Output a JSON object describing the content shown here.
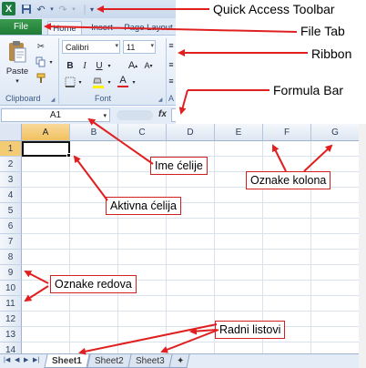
{
  "app": {
    "logo_letter": "X",
    "tabs": {
      "file": "File",
      "home": "Home",
      "insert": "Insert",
      "page_layout": "Page Layout"
    },
    "ribbon": {
      "paste_label": "Paste",
      "clipboard_label": "Clipboard",
      "font_label": "Font",
      "font_name": "Calibri",
      "font_size": "11",
      "bold": "B",
      "italic": "I",
      "underline": "U",
      "grow_font": "A",
      "shrink_font": "A",
      "font_color": "A",
      "partial_group_letter": "A"
    },
    "name_box": "A1",
    "fx_label": "fx",
    "columns": [
      "A",
      "B",
      "C",
      "D",
      "E",
      "F",
      "G"
    ],
    "rows": [
      "1",
      "2",
      "3",
      "4",
      "5",
      "6",
      "7",
      "8",
      "9",
      "10",
      "11",
      "12",
      "13",
      "14"
    ],
    "selected_column": "A",
    "selected_row": "1",
    "sheets": [
      "Sheet1",
      "Sheet2",
      "Sheet3"
    ],
    "active_sheet": "Sheet1"
  },
  "callouts": {
    "quick_access_toolbar": "Quick Access Toolbar",
    "file_tab": "File Tab",
    "ribbon": "Ribbon",
    "formula_bar": "Formula Bar",
    "ime_celije": "Ime ćelije",
    "oznake_kolona": "Oznake kolona",
    "aktivna_celija": "Aktivna ćelija",
    "oznake_redova": "Oznake redova",
    "radni_listovi": "Radni listovi"
  },
  "colors": {
    "arrow": "#e02020",
    "file_tab": "#207a36",
    "selection": "#f1c15f"
  }
}
